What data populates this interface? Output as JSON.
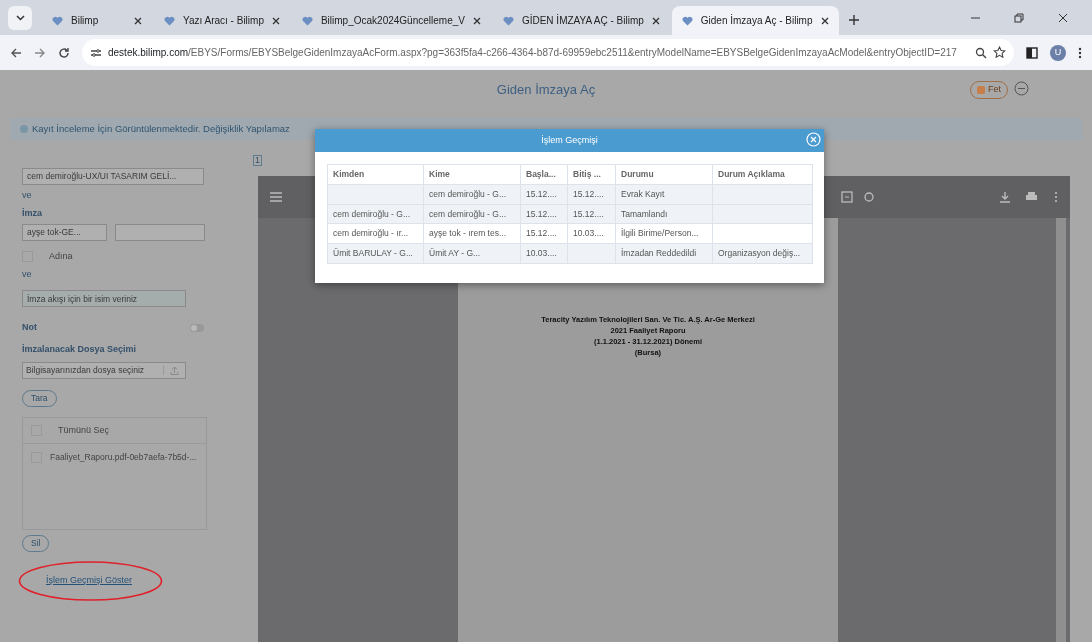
{
  "browser": {
    "tabs": [
      {
        "title": "Bilimp",
        "selected": false
      },
      {
        "title": "Yazı Aracı - Bilimp",
        "selected": false
      },
      {
        "title": "Bilimp_Ocak2024Güncelleme_V",
        "selected": false
      },
      {
        "title": "GİDEN İMZAYA AÇ - Bilimp",
        "selected": false
      },
      {
        "title": "Giden İmzaya Aç - Bilimp",
        "selected": true
      }
    ],
    "url_host": "destek.bilimp.com",
    "url_path": "/EBYS/Forms/EBYSBelgeGidenImzayaAcForm.aspx?pg=363f5fa4-c266-4364-b87d-69959ebc2511&entryModelName=EBYSBelgeGidenImzayaAcModel&entryObjectID=217",
    "profile_initial": "U"
  },
  "page": {
    "title": "Giden İmzaya Aç",
    "fet_button": "Fet",
    "info_message": "Kayıt İnceleme İçin Görüntülenmektedir. Değişiklik Yapılamaz"
  },
  "form": {
    "recipient_select": "cem demiroğlu-UX/UI TASARIM GELİ...",
    "connector_1": "ve",
    "signature_label": "İmza",
    "signature_select": "ayşe tok-GE...",
    "on_behalf": {
      "label": "Adına",
      "checked": false
    },
    "connector_2": "ve",
    "flow_name": {
      "placeholder": "İmza akışı için bir isim veriniz"
    },
    "note": {
      "label": "Not",
      "on": false
    },
    "file_heading": "İmzalanacak Dosya Seçimi",
    "file_field": {
      "placeholder": "Bilgisayarınızdan dosya seçiniz"
    },
    "scan_button": "Tara",
    "select_all": {
      "label": "Tümünü Seç",
      "checked": false
    },
    "files": [
      {
        "name": "Faaliyet_Raporu.pdf-0eb7aefa-7b5d-...",
        "checked": false
      }
    ],
    "delete_button": "Sil",
    "history_link": "İşlem Geçmişi Göster"
  },
  "viewer": {
    "page_number": "1",
    "document_lines": [
      "Teracity Yazılım Teknolojileri San. Ve Tic. A.Ş. Ar-Ge Merkezi",
      "2021 Faaliyet Raporu",
      "(1.1.2021 - 31.12.2021) Dönemi",
      "(Bursa)"
    ]
  },
  "modal": {
    "title": "İşlem Geçmişi",
    "columns": [
      "Kimden",
      "Kime",
      "Başla...",
      "Bitiş ...",
      "Durumu",
      "Durum Açıklama"
    ],
    "rows": [
      [
        "",
        "cem demiroğlu - G...",
        "15.12....",
        "15.12....",
        "Evrak Kayıt",
        ""
      ],
      [
        "cem demiroğlu - G...",
        "cem demiroğlu - G...",
        "15.12....",
        "15.12....",
        "Tamamlandı",
        ""
      ],
      [
        "cem demiroğlu - ır...",
        "ayşe tok - ırem tes...",
        "15.12....",
        "10.03....",
        "İlgili Birime/Person...",
        ""
      ],
      [
        "Ümit BARULAY - G...",
        "Ümit AY - G...",
        "10.03....",
        "",
        "İmzadan Reddedildi",
        "Organizasyon değiş..."
      ]
    ]
  }
}
